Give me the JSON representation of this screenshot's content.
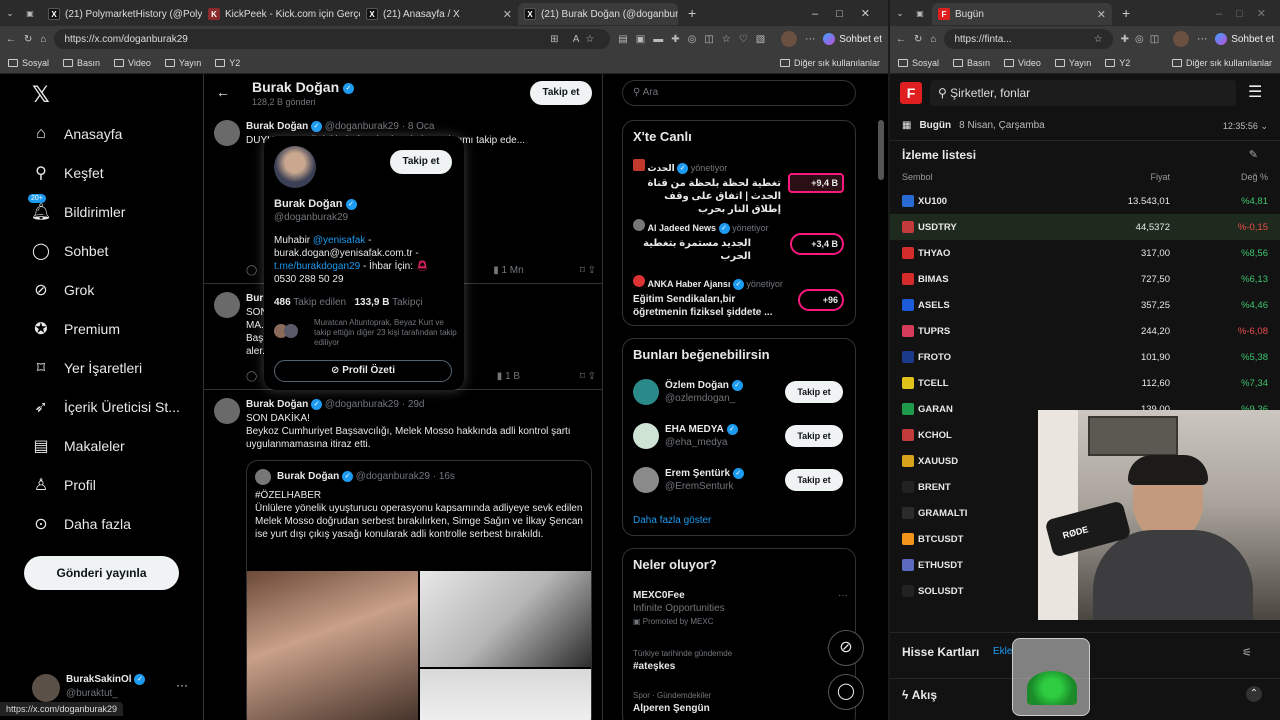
{
  "left_window": {
    "tabs": [
      {
        "label": "(21) PolymarketHistory (@Polymar"
      },
      {
        "label": "KickPeek - Kick.com için Gerçek Z"
      },
      {
        "label": "(21) Anasayfa / X"
      },
      {
        "label": "(21) Burak Doğan (@doganburak2"
      }
    ],
    "url": "https://x.com/doganburak29",
    "sohbet_label": "Sohbet et",
    "bookmarks": [
      "Sosyal",
      "Basın",
      "Video",
      "Yayın",
      "Y2"
    ],
    "bookmarks_other": "Diğer sık kullanılanlar",
    "status_url": "https://x.com/doganburak29"
  },
  "x": {
    "nav": [
      {
        "label": "Anasayfa",
        "icon": "home-icon"
      },
      {
        "label": "Keşfet",
        "icon": "search-icon"
      },
      {
        "label": "Bildirimler",
        "icon": "bell-icon"
      },
      {
        "label": "Sohbet",
        "icon": "chat-icon"
      },
      {
        "label": "Grok",
        "icon": "grok-icon"
      },
      {
        "label": "Premium",
        "icon": "premium-icon"
      },
      {
        "label": "Yer İşaretleri",
        "icon": "bookmark-icon"
      },
      {
        "label": "İçerik Üreticisi St...",
        "icon": "rocket-icon"
      },
      {
        "label": "Makaleler",
        "icon": "article-icon"
      },
      {
        "label": "Profil",
        "icon": "profile-icon"
      },
      {
        "label": "Daha fazla",
        "icon": "more-icon"
      }
    ],
    "notif_badge": "20+",
    "post_button": "Gönderi yayınla",
    "account": {
      "name": "BurakSakinOl",
      "handle": "@buraktut_"
    },
    "header": {
      "name": "Burak Doğan",
      "posts": "128,2 B gönderi",
      "follow": "Takip et"
    },
    "tweets": [
      {
        "name": "Burak Doğan",
        "handle": "@doganburak29",
        "date": "8 Oca",
        "text": "DUYURU: Aşağıdaki platformlardan da hesaplarımı takip ede...",
        "views": "1 Mn"
      },
      {
        "name": "Bur",
        "text1": "SON",
        "text2": "MA... ak, Bakırköy Cumhuriyet",
        "text3": "Baş... nda \"halkı yanıltıcı bilgiyi",
        "text4": "aler...",
        "views": "1 B"
      },
      {
        "name": "Burak Doğan",
        "handle": "@doganburak29",
        "date": "29d",
        "title": "SON DAKİKA!",
        "text": "Beykoz Cumhuriyet Başsavcılığı, Melek Mosso hakkında adli kontrol şartı uygulanmamasına itiraz etti.",
        "quote": {
          "name": "Burak Doğan",
          "handle": "@doganburak29",
          "date": "16s",
          "title": "#ÖZELHABER",
          "text": "Ünlülere yönelik uyuşturucu operasyonu kapsamında adliyeye sevk edilen Melek Mosso doğrudan serbest bırakılırken, Simge Sağın ve İlkay Şencan ise yurt dışı çıkış yasağı konularak adli kontrolle serbest bırakıldı."
        }
      }
    ],
    "hover": {
      "name": "Burak Doğan",
      "handle": "@doganburak29",
      "follow": "Takip et",
      "bio1_a": "Muhabir ",
      "bio1_link": "@yenisafak",
      "bio1_b": " -",
      "bio2": "burak.dogan@yenisafak.com.tr -",
      "bio3_link": "t.me/burakdogan29",
      "bio3_b": " - İhbar İçin: ",
      "phone": "0530 288 50 29",
      "following": "486",
      "following_label": "Takip edilen",
      "followers": "133,9 B",
      "followers_label": "Takipçi",
      "mutual": "Muratcan Altuntoprak, Beyaz Kurt ve takip ettiğin diğer 23 kişi tarafından takip ediliyor",
      "profile_btn": "Profil Özeti"
    },
    "search_placeholder": "Ara",
    "live": {
      "title": "X'te Canlı",
      "items": [
        {
          "name": "الحدث",
          "tag": "yönetiyor",
          "text": "تغطية لحظة بلحظة من قناة الحدث | اتفاق على وقف إطلاق النار بحرب",
          "count": "+9,4 B"
        },
        {
          "name": "Al Jadeed News",
          "tag": "yönetiyor",
          "text": "الجديد مستمرة بتغطية الحرب",
          "count": "+3,4 B"
        },
        {
          "name": "ANKA Haber Ajansı",
          "tag": "yönetiyor",
          "text": "Eğitim Sendikaları,bir öğretmenin fiziksel şiddete ...",
          "count": "+96"
        }
      ]
    },
    "suggest": {
      "title": "Bunları beğenebilirsin",
      "items": [
        {
          "name": "Özlem Doğan",
          "handle": "@ozlemdogan_",
          "btn": "Takip et"
        },
        {
          "name": "EHA MEDYA",
          "handle": "@eha_medya",
          "btn": "Takip et"
        },
        {
          "name": "Erem Şentürk",
          "handle": "@EremSenturk",
          "btn": "Takip et"
        }
      ],
      "more": "Daha fazla göster"
    },
    "trends": {
      "title": "Neler oluyor?",
      "items": [
        {
          "name": "MEXC0Fee",
          "sub": "Infinite Opportunities",
          "promo": "Promoted by MEXC"
        },
        {
          "meta": "Türkiye tarihinde gündemde",
          "name": "#ateşkes"
        },
        {
          "meta": "Spor · Gündemdekiler",
          "name": "Alperen Şengün"
        }
      ]
    }
  },
  "right_window": {
    "tab": "Bugün",
    "url": "https://finta...",
    "sohbet_label": "Sohbet et",
    "bookmarks": [
      "Sosyal",
      "Basın",
      "Video",
      "Yayın",
      "Y2"
    ],
    "bookmarks_other": "Diğer sık kullanılanlar",
    "search_placeholder": "Şirketler, fonlar",
    "today": "Bugün",
    "date": "8 Nisan, Çarşamba",
    "time": "12:35:56",
    "watch_title": "İzleme listesi",
    "cols": [
      "Sembol",
      "Fiyat",
      "Değ %"
    ],
    "rows": [
      {
        "sym": "XU100",
        "price": "13.543,01",
        "chg": "%4,81",
        "color": "#3ec46d",
        "ic": "#2a6ad4"
      },
      {
        "sym": "USDTRY",
        "price": "44,5372",
        "chg": "%-0,15",
        "color": "#ef4c4c",
        "ic": "#c23b3b"
      },
      {
        "sym": "THYAO",
        "price": "317,00",
        "chg": "%8,56",
        "color": "#3ec46d",
        "ic": "#d42b2b"
      },
      {
        "sym": "BIMAS",
        "price": "727,50",
        "chg": "%6,13",
        "color": "#3ec46d",
        "ic": "#d42b2b"
      },
      {
        "sym": "ASELS",
        "price": "357,25",
        "chg": "%4,46",
        "color": "#3ec46d",
        "ic": "#1e5bd8"
      },
      {
        "sym": "TUPRS",
        "price": "244,20",
        "chg": "%-6,08",
        "color": "#ef4c4c",
        "ic": "#d43b5a"
      },
      {
        "sym": "FROTO",
        "price": "101,90",
        "chg": "%5,38",
        "color": "#3ec46d",
        "ic": "#1b3b8a"
      },
      {
        "sym": "TCELL",
        "price": "112,60",
        "chg": "%7,34",
        "color": "#3ec46d",
        "ic": "#e0c21a"
      },
      {
        "sym": "GARAN",
        "price": "139,00",
        "chg": "%9,36",
        "color": "#3ec46d",
        "ic": "#1e9b4a"
      },
      {
        "sym": "KCHOL",
        "price": "",
        "chg": "",
        "color": "#3ec46d",
        "ic": "#c23b3b"
      },
      {
        "sym": "XAUUSD",
        "price": "",
        "chg": "",
        "color": "#3ec46d",
        "ic": "#d8a21a"
      },
      {
        "sym": "BRENT",
        "price": "",
        "chg": "",
        "color": "#3ec46d",
        "ic": "#222"
      },
      {
        "sym": "GRAMALTI",
        "price": "",
        "chg": "",
        "color": "#3ec46d",
        "ic": "#2b2b2b"
      },
      {
        "sym": "BTCUSDT",
        "price": "",
        "chg": "",
        "color": "#3ec46d",
        "ic": "#f2931a"
      },
      {
        "sym": "ETHUSDT",
        "price": "",
        "chg": "",
        "color": "#3ec46d",
        "ic": "#5c6bc0"
      },
      {
        "sym": "SOLUSDT",
        "price": "",
        "chg": "",
        "color": "#3ec46d",
        "ic": "#222"
      }
    ],
    "cards_title": "Hisse Kartları",
    "cards_link": "Ekle",
    "flow": "Akış",
    "mic_brand": "RØDE"
  }
}
